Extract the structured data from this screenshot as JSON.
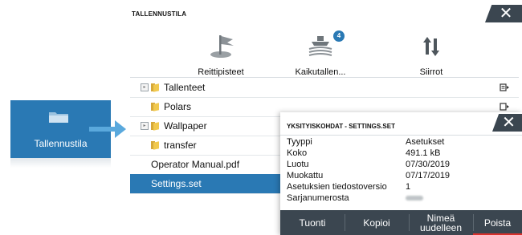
{
  "launcher": {
    "label": "Tallennustila",
    "icon": "folder-icon"
  },
  "window": {
    "title": "TALLENNUSTILA",
    "close_label": "✕",
    "tools": [
      {
        "label": "Reittipisteet",
        "icon": "waypoint-flag-icon"
      },
      {
        "label": "Kaikutallen...",
        "icon": "echo-recording-icon",
        "badge": "4"
      },
      {
        "label": "Siirrot",
        "icon": "transfer-arrows-icon"
      }
    ],
    "files": [
      {
        "name": "Tallenteet",
        "type": "folder",
        "expandable": true
      },
      {
        "name": "Polars",
        "type": "folder",
        "expandable": false
      },
      {
        "name": "Wallpaper",
        "type": "folder",
        "expandable": true
      },
      {
        "name": "transfer",
        "type": "folder",
        "expandable": false
      },
      {
        "name": "Operator Manual.pdf",
        "type": "file"
      },
      {
        "name": "Settings.set",
        "type": "file",
        "selected": true
      }
    ]
  },
  "details": {
    "title": "YKSITYISKOHDAT - SETTINGS.SET",
    "close_label": "✕",
    "rows": [
      {
        "key": "Tyyppi",
        "value": "Asetukset"
      },
      {
        "key": "Koko",
        "value": "491.1 kB"
      },
      {
        "key": "Luotu",
        "value": "07/30/2019"
      },
      {
        "key": "Muokattu",
        "value": "07/17/2019"
      },
      {
        "key": "Asetuksien tiedostoversio",
        "value": "1"
      },
      {
        "key": "Sarjanumerosta",
        "value": ""
      }
    ],
    "buttons": {
      "import": "Tuonti",
      "copy": "Kopioi",
      "rename_line1": "Nimeä",
      "rename_line2": "uudelleen",
      "delete": "Poista"
    }
  },
  "colors": {
    "accent": "#2a79b4",
    "dark": "#3b4650",
    "danger": "#d9302b",
    "folder": "#f1c94e"
  }
}
